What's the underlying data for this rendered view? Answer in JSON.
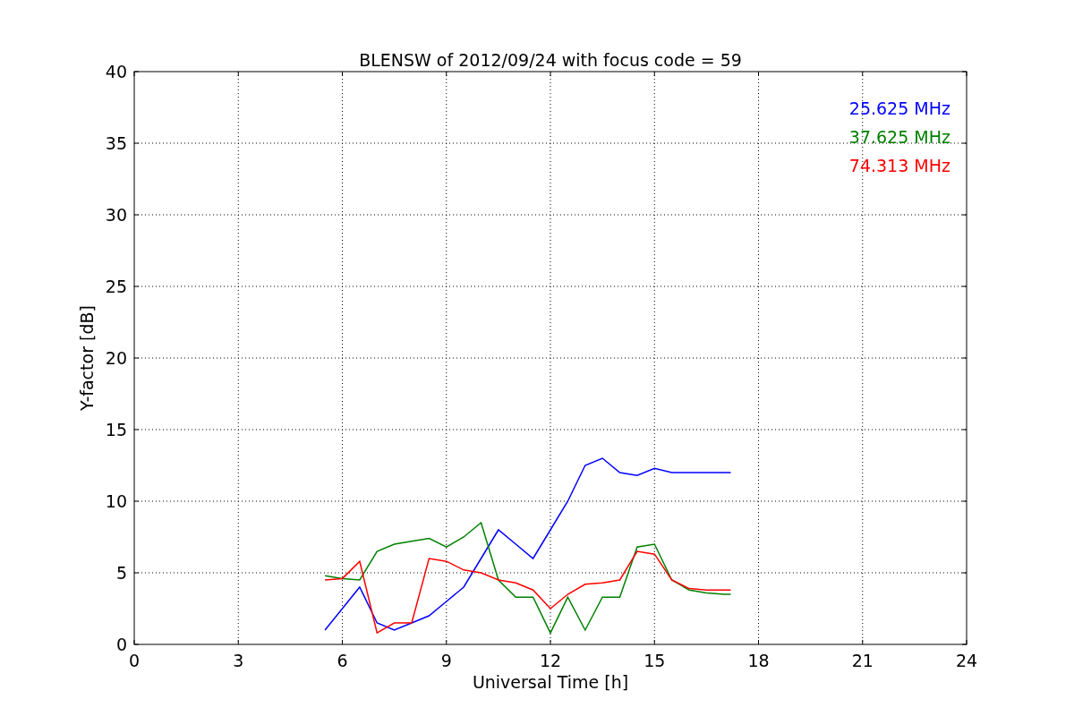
{
  "figure": {
    "chart_data": {
      "type": "line",
      "title": "BLENSW of 2012/09/24 with focus code = 59",
      "xlabel": "Universal Time [h]",
      "ylabel": "Y-factor [dB]",
      "x": [
        5.5,
        6,
        6.5,
        7,
        7.5,
        8,
        8.5,
        9,
        9.5,
        10,
        10.5,
        11,
        11.5,
        12,
        12.5,
        13,
        13.5,
        14,
        14.5,
        15,
        15.5,
        16,
        16.5,
        17,
        17.2
      ],
      "series": [
        {
          "name": "25.625 MHz",
          "color": "#0000ff",
          "values": [
            1,
            2.5,
            4,
            1.5,
            1,
            1.5,
            2,
            3,
            4,
            6,
            8,
            7,
            6,
            8,
            10,
            12.5,
            13,
            12,
            11.8,
            12.3,
            12,
            12,
            12,
            12,
            12
          ]
        },
        {
          "name": "37.625 MHz",
          "color": "#008000",
          "values": [
            4.8,
            4.6,
            4.5,
            6.5,
            7,
            7.2,
            7.4,
            6.8,
            7.5,
            8.5,
            4.5,
            3.3,
            3.3,
            0.8,
            3.3,
            1,
            3.3,
            3.3,
            6.8,
            7,
            4.5,
            3.8,
            3.6,
            3.5,
            3.5
          ]
        },
        {
          "name": "74.313 MHz",
          "color": "#ff0000",
          "values": [
            4.5,
            4.6,
            5.8,
            0.8,
            1.5,
            1.5,
            6,
            5.8,
            5.2,
            5,
            4.5,
            4.3,
            3.8,
            2.5,
            3.5,
            4.2,
            4.3,
            4.5,
            6.5,
            6.3,
            4.5,
            3.9,
            3.8,
            3.8,
            3.8
          ]
        }
      ],
      "grid": true,
      "xlim": [
        0,
        24
      ],
      "ylim": [
        0,
        40
      ],
      "xticks": [
        0,
        3,
        6,
        9,
        12,
        15,
        18,
        21,
        24
      ],
      "yticks": [
        0,
        5,
        10,
        15,
        20,
        25,
        30,
        35,
        40
      ]
    }
  }
}
